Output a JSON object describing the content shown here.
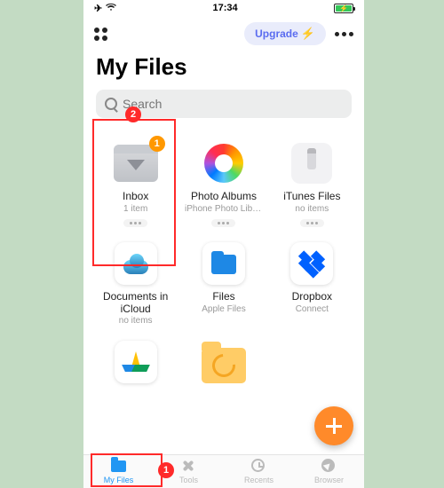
{
  "status": {
    "time": "17:34"
  },
  "header": {
    "upgrade": "Upgrade",
    "title": "My Files"
  },
  "search": {
    "placeholder": "Search"
  },
  "tiles": [
    {
      "name": "Inbox",
      "sub": "1 item",
      "badge": "1"
    },
    {
      "name": "Photo Albums",
      "sub": "iPhone Photo Libra..."
    },
    {
      "name": "iTunes Files",
      "sub": "no items"
    },
    {
      "name": "Documents in iCloud",
      "sub": "no items"
    },
    {
      "name": "Files",
      "sub": "Apple Files"
    },
    {
      "name": "Dropbox",
      "sub": "Connect"
    },
    {
      "name": "",
      "sub": ""
    },
    {
      "name": "",
      "sub": ""
    }
  ],
  "tabs": [
    {
      "label": "My Files"
    },
    {
      "label": "Tools"
    },
    {
      "label": "Recents"
    },
    {
      "label": "Browser"
    }
  ],
  "callouts": {
    "tab": "1",
    "tile": "2"
  }
}
